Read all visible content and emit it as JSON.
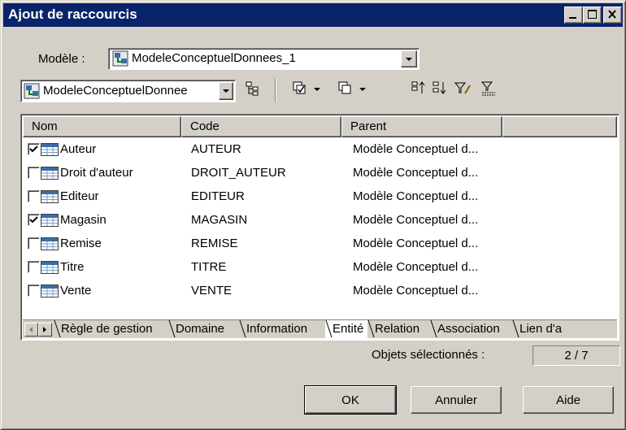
{
  "window": {
    "title": "Ajout de raccourcis"
  },
  "model_selector": {
    "label": "Modèle :",
    "value": "ModeleConceptuelDonnees_1",
    "icon": "model-icon"
  },
  "toolbar": {
    "package_value": "ModeleConceptuelDonnee",
    "tools": [
      "include-subpackages-icon",
      "select-all-icon",
      "deselect-all-icon",
      "move-top-icon",
      "move-bottom-icon",
      "filter-edit-icon",
      "filter-clear-icon"
    ]
  },
  "list": {
    "columns": [
      "Nom",
      "Code",
      "Parent"
    ],
    "rows": [
      {
        "checked": true,
        "name": "Auteur",
        "code": "AUTEUR",
        "parent": "Modèle Conceptuel d..."
      },
      {
        "checked": false,
        "name": "Droit d'auteur",
        "code": "DROIT_AUTEUR",
        "parent": "Modèle Conceptuel d..."
      },
      {
        "checked": false,
        "name": "Editeur",
        "code": "EDITEUR",
        "parent": "Modèle Conceptuel d..."
      },
      {
        "checked": true,
        "name": "Magasin",
        "code": "MAGASIN",
        "parent": "Modèle Conceptuel d..."
      },
      {
        "checked": false,
        "name": "Remise",
        "code": "REMISE",
        "parent": "Modèle Conceptuel d..."
      },
      {
        "checked": false,
        "name": "Titre",
        "code": "TITRE",
        "parent": "Modèle Conceptuel d..."
      },
      {
        "checked": false,
        "name": "Vente",
        "code": "VENTE",
        "parent": "Modèle Conceptuel d..."
      }
    ]
  },
  "tabs": {
    "items": [
      "Règle de gestion",
      "Domaine",
      "Information",
      "Entité",
      "Relation",
      "Association",
      "Lien d'a"
    ],
    "active": "Entité"
  },
  "status": {
    "label": "Objets sélectionnés :",
    "value": "2 / 7"
  },
  "buttons": {
    "ok": "OK",
    "cancel": "Annuler",
    "help": "Aide"
  },
  "colors": {
    "titlebar": "#0a246a",
    "face": "#d4d0c8",
    "entity_icon": "#3a6ea5"
  }
}
